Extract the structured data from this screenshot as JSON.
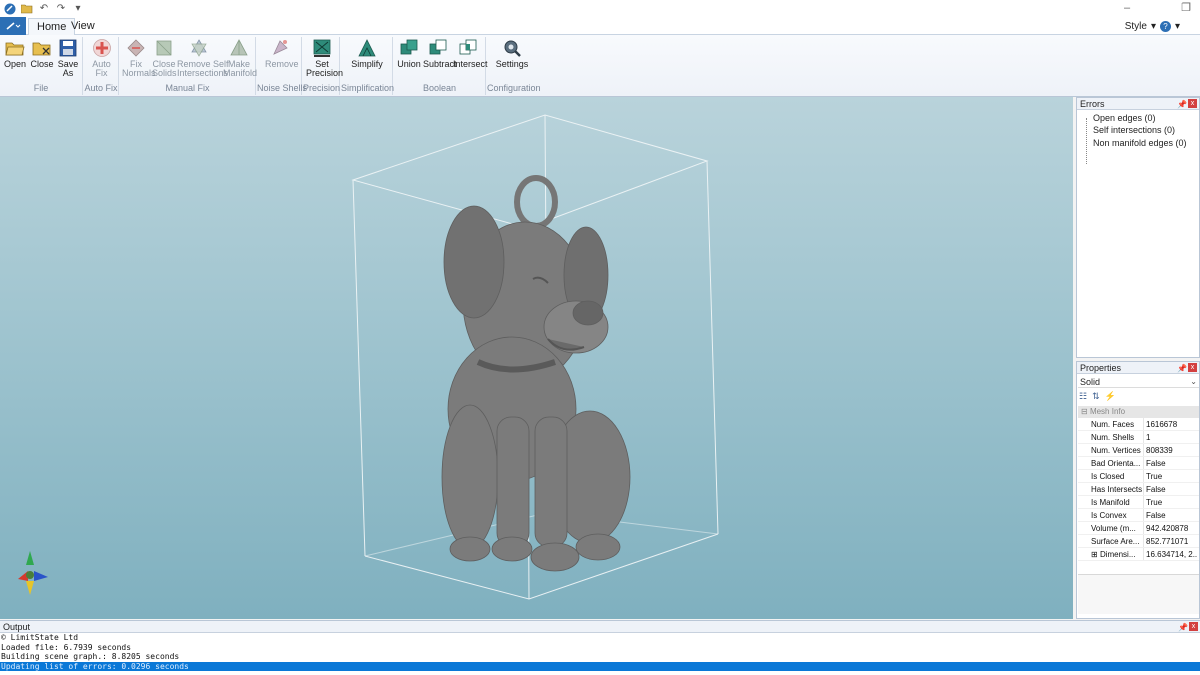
{
  "titlebar": {
    "quick_access_icons": [
      "app-logo-icon",
      "open-folder-icon",
      "undo-icon",
      "redo-icon",
      "customize-icon"
    ],
    "window_buttons": [
      "minimize-icon",
      "restore-icon"
    ]
  },
  "tabs": [
    {
      "label": "Home",
      "active": true
    },
    {
      "label": "View",
      "active": false
    }
  ],
  "style_menu": {
    "label": "Style",
    "help": "?"
  },
  "ribbon": {
    "groups": [
      {
        "label": "File",
        "buttons": [
          {
            "label": "Open",
            "icon": "open-folder-icon",
            "enabled": true
          },
          {
            "label": "Close",
            "icon": "close-folder-icon",
            "enabled": true
          },
          {
            "label": "Save\nAs",
            "icon": "save-icon",
            "enabled": true
          }
        ]
      },
      {
        "label": "Auto Fix",
        "buttons": [
          {
            "label": "Auto\nFix",
            "icon": "auto-fix-icon",
            "enabled": false
          }
        ]
      },
      {
        "label": "Manual Fix",
        "buttons": [
          {
            "label": "Fix\nNormals",
            "icon": "fix-normals-icon",
            "enabled": false
          },
          {
            "label": "Close\nSolids",
            "icon": "close-solids-icon",
            "enabled": false
          },
          {
            "label": "Remove Self\nIntersections",
            "icon": "remove-intersections-icon",
            "enabled": false
          },
          {
            "label": "Make\nManifold",
            "icon": "make-manifold-icon",
            "enabled": false
          }
        ]
      },
      {
        "label": "Noise Shells",
        "buttons": [
          {
            "label": "Remove",
            "icon": "remove-shells-icon",
            "enabled": false
          }
        ]
      },
      {
        "label": "Precision",
        "buttons": [
          {
            "label": "Set\nPrecision",
            "icon": "set-precision-icon",
            "enabled": true
          }
        ]
      },
      {
        "label": "Simplification",
        "buttons": [
          {
            "label": "Simplify",
            "icon": "simplify-icon",
            "enabled": true
          }
        ]
      },
      {
        "label": "Boolean",
        "buttons": [
          {
            "label": "Union",
            "icon": "union-icon",
            "enabled": true
          },
          {
            "label": "Subtract",
            "icon": "subtract-icon",
            "enabled": true
          },
          {
            "label": "Intersect",
            "icon": "intersect-icon",
            "enabled": true
          }
        ]
      },
      {
        "label": "Configuration",
        "buttons": [
          {
            "label": "Settings",
            "icon": "settings-gear-icon",
            "enabled": true
          }
        ]
      }
    ]
  },
  "errors_panel": {
    "title": "Errors",
    "items": [
      "Open edges (0)",
      "Self intersections (0)",
      "Non manifold edges (0)"
    ]
  },
  "properties_panel": {
    "title": "Properties",
    "selected_object": "Solid",
    "toolbar_icons": [
      "categorized-icon",
      "alphabetical-icon",
      "events-icon"
    ],
    "category": "Mesh Info",
    "rows": [
      {
        "key": "Num. Faces",
        "value": "1616678"
      },
      {
        "key": "Num. Shells",
        "value": "1"
      },
      {
        "key": "Num. Vertices",
        "value": "808339"
      },
      {
        "key": "Bad Orienta...",
        "value": "False"
      },
      {
        "key": "Is Closed",
        "value": "True"
      },
      {
        "key": "Has Intersects",
        "value": "False"
      },
      {
        "key": "Is Manifold",
        "value": "True"
      },
      {
        "key": "Is Convex",
        "value": "False"
      },
      {
        "key": "Volume (m...",
        "value": "942.420878"
      },
      {
        "key": "Surface Are...",
        "value": "852.771071"
      },
      {
        "key": "Dimensi...",
        "value": "16.634714, 2..."
      }
    ]
  },
  "output_panel": {
    "title": "Output",
    "lines": [
      "© LimitState Ltd",
      "Loaded file: 6.7939 seconds",
      "Building scene graph.: 8.8205 seconds",
      "Updating list of errors: 0.0296 seconds"
    ]
  },
  "viewport": {
    "background_top": "#b9d3db",
    "background_bottom": "#7fb0bf",
    "model_color": "#7b7b7b",
    "axis_colors": [
      "#2fa84f",
      "#d63a2f",
      "#2a53c9",
      "#e6c52a"
    ]
  },
  "colors": {
    "accent": "#2c6fb5",
    "selection": "#0a78d7",
    "close_button": "#d34040"
  }
}
